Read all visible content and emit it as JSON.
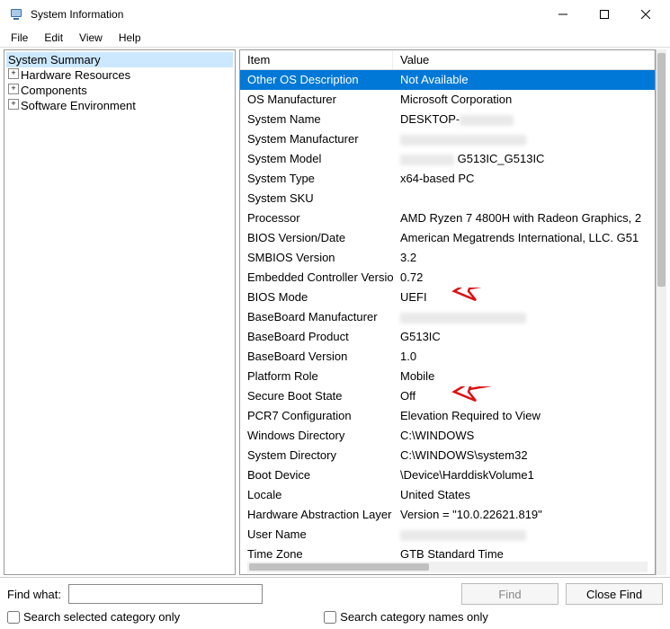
{
  "window": {
    "title": "System Information"
  },
  "menu": {
    "file": "File",
    "edit": "Edit",
    "view": "View",
    "help": "Help"
  },
  "tree": {
    "root": "System Summary",
    "items": [
      "Hardware Resources",
      "Components",
      "Software Environment"
    ]
  },
  "list": {
    "header_item": "Item",
    "header_value": "Value",
    "rows": [
      {
        "item": "Other OS Description",
        "value": "Not Available",
        "selected": true
      },
      {
        "item": "OS Manufacturer",
        "value": "Microsoft Corporation"
      },
      {
        "item": "System Name",
        "value": "DESKTOP-",
        "redacted_after": true
      },
      {
        "item": "System Manufacturer",
        "value": "",
        "redacted": true
      },
      {
        "item": "System Model",
        "value": " G513IC_G513IC",
        "redacted_before": true
      },
      {
        "item": "System Type",
        "value": "x64-based PC"
      },
      {
        "item": "System SKU",
        "value": ""
      },
      {
        "item": "Processor",
        "value": "AMD Ryzen 7 4800H with Radeon Graphics, 2"
      },
      {
        "item": "BIOS Version/Date",
        "value": "American Megatrends International, LLC. G51"
      },
      {
        "item": "SMBIOS Version",
        "value": "3.2"
      },
      {
        "item": "Embedded Controller Version",
        "value": "0.72"
      },
      {
        "item": "BIOS Mode",
        "value": "UEFI",
        "arrow": 1
      },
      {
        "item": "BaseBoard Manufacturer",
        "value": "",
        "redacted": true
      },
      {
        "item": "BaseBoard Product",
        "value": "G513IC"
      },
      {
        "item": "BaseBoard Version",
        "value": "1.0"
      },
      {
        "item": "Platform Role",
        "value": "Mobile"
      },
      {
        "item": "Secure Boot State",
        "value": "Off",
        "arrow": 2
      },
      {
        "item": "PCR7 Configuration",
        "value": "Elevation Required to View"
      },
      {
        "item": "Windows Directory",
        "value": "C:\\WINDOWS"
      },
      {
        "item": "System Directory",
        "value": "C:\\WINDOWS\\system32"
      },
      {
        "item": "Boot Device",
        "value": "\\Device\\HarddiskVolume1"
      },
      {
        "item": "Locale",
        "value": "United States"
      },
      {
        "item": "Hardware Abstraction Layer",
        "value": "Version = \"10.0.22621.819\""
      },
      {
        "item": "User Name",
        "value": "",
        "redacted": true
      },
      {
        "item": "Time Zone",
        "value": "GTB Standard Time"
      }
    ]
  },
  "find": {
    "label": "Find what:",
    "find_btn": "Find",
    "close_btn": "Close Find"
  },
  "checks": {
    "selected_only": "Search selected category only",
    "names_only": "Search category names only"
  }
}
